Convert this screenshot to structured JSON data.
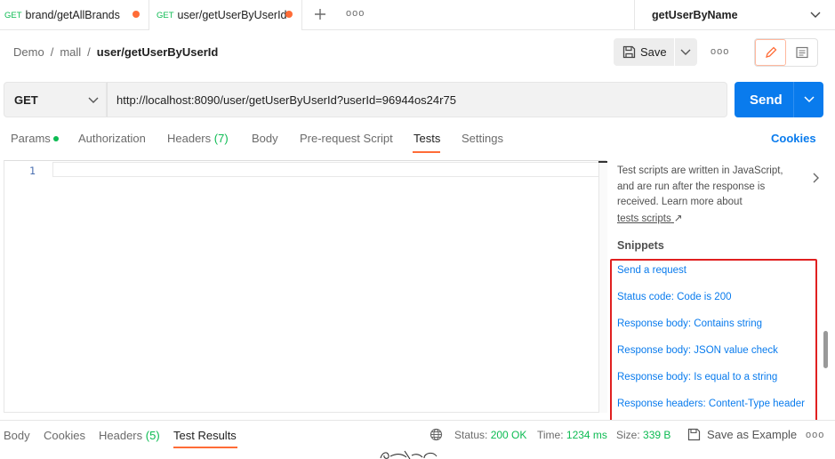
{
  "tabs": [
    {
      "method": "GET",
      "label": "brand/getAllBrands"
    },
    {
      "method": "GET",
      "label": "user/getUserByUserId"
    }
  ],
  "tab_actions": {
    "more": "ooo"
  },
  "environment": "getUserByName",
  "breadcrumb": [
    "Demo",
    "/",
    "mall",
    "/",
    "user/getUserByUserId"
  ],
  "toolbar": {
    "save_label": "Save",
    "more": "ooo"
  },
  "request": {
    "method": "GET",
    "url": "http://localhost:8090/user/getUserByUserId?userId=96944os24r75",
    "send_label": "Send"
  },
  "request_tabs": {
    "params": "Params",
    "authorization": "Authorization",
    "headers": "Headers",
    "headers_count": "(7)",
    "body": "Body",
    "pre_request": "Pre-request Script",
    "tests": "Tests",
    "settings": "Settings",
    "cookies": "Cookies"
  },
  "editor": {
    "line_number": "1"
  },
  "side_panel": {
    "description": "Test scripts are written in JavaScript, and are run after the response is received. Learn more about",
    "link": "tests scripts",
    "link_arrow": "↗",
    "snippets_heading": "Snippets",
    "snippets": [
      "Send a request",
      "Status code: Code is 200",
      "Response body: Contains string",
      "Response body: JSON value check",
      "Response body: Is equal to a string",
      "Response headers: Content-Type header"
    ]
  },
  "response": {
    "tabs": {
      "body": "Body",
      "cookies": "Cookies",
      "headers": "Headers",
      "headers_count": "(5)",
      "test_results": "Test Results"
    },
    "status_label": "Status:",
    "status_value": "200 OK",
    "time_label": "Time:",
    "time_value": "1234 ms",
    "size_label": "Size:",
    "size_value": "339 B",
    "save_example": "Save as Example",
    "more": "ooo"
  },
  "colors": {
    "accent": "#ff6c37",
    "primary": "#097bed",
    "success": "#0cbb52",
    "highlight": "#e02020"
  },
  "icons": [
    "plus-icon",
    "chevron-down-icon",
    "save-icon",
    "pencil-icon",
    "doc-icon",
    "chevron-right-icon",
    "globe-icon",
    "save-example-icon"
  ]
}
